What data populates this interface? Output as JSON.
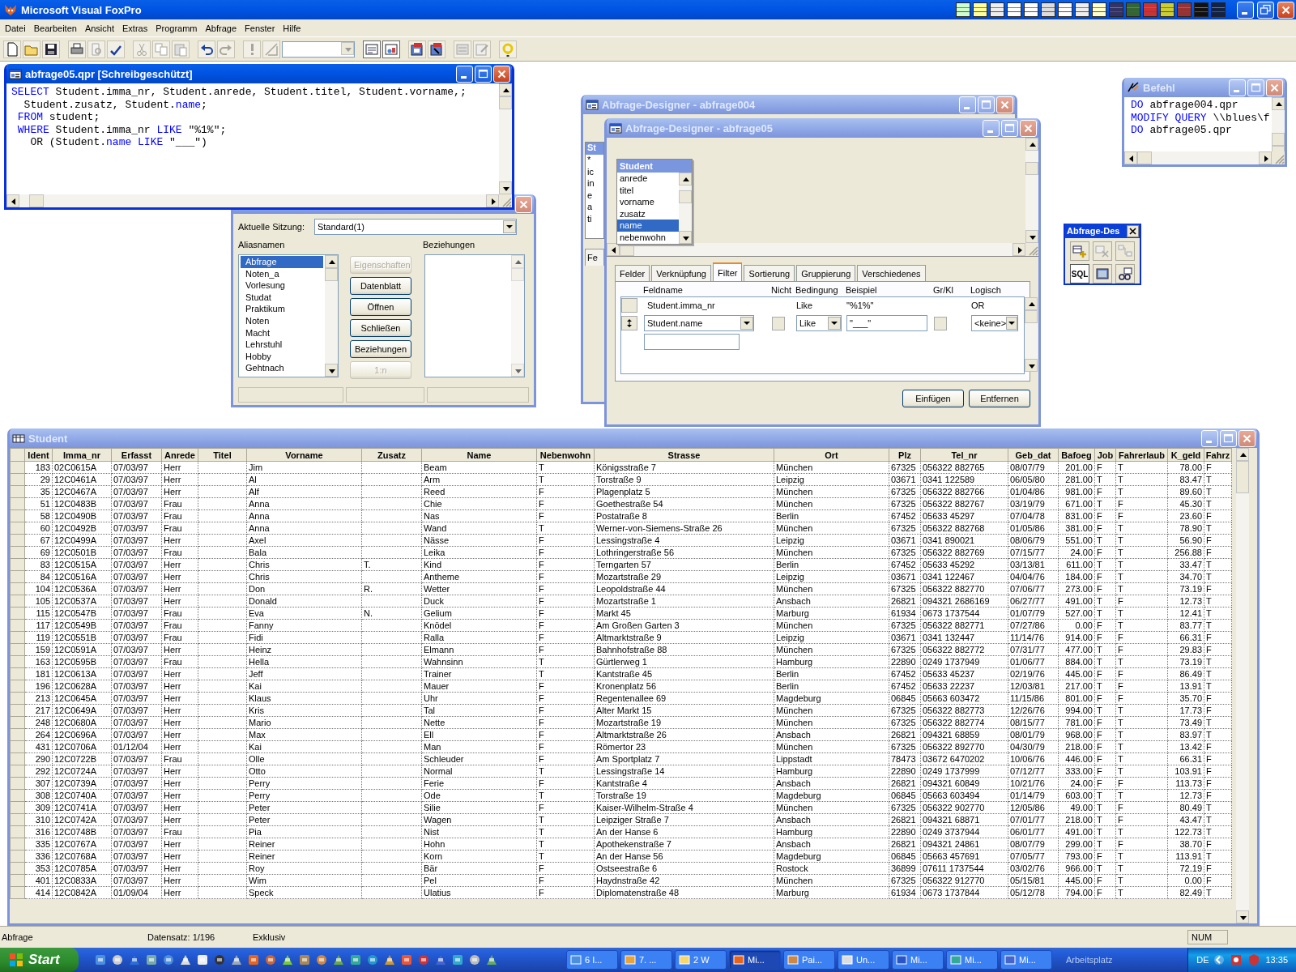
{
  "app": {
    "title": "Microsoft Visual FoxPro"
  },
  "menu": [
    "Datei",
    "Bearbeiten",
    "Ansicht",
    "Extras",
    "Programm",
    "Abfrage",
    "Fenster",
    "Hilfe"
  ],
  "code_window": {
    "title": "abfrage05.qpr [Schreibgeschützt]",
    "active": true,
    "lines": [
      [
        {
          "text": "SELECT",
          "kind": "keyword"
        },
        {
          "text": " Student.imma_nr, Student.anrede, Student.titel, Student.vorname,;",
          "kind": "plain"
        }
      ],
      [
        {
          "text": "  Student.zusatz, Student.",
          "kind": "plain"
        },
        {
          "text": "name",
          "kind": "keyword"
        },
        {
          "text": ";",
          "kind": "plain"
        }
      ],
      [
        {
          "text": " FROM",
          "kind": "keyword"
        },
        {
          "text": " student;",
          "kind": "plain"
        }
      ],
      [
        {
          "text": " WHERE",
          "kind": "keyword"
        },
        {
          "text": " Student.imma_nr ",
          "kind": "plain"
        },
        {
          "text": "LIKE",
          "kind": "keyword"
        },
        {
          "text": " \"%1%\";",
          "kind": "plain"
        }
      ],
      [
        {
          "text": "   OR (Student.",
          "kind": "plain"
        },
        {
          "text": "name",
          "kind": "keyword"
        },
        {
          "text": " LIKE",
          "kind": "keyword"
        },
        {
          "text": " \"___\")",
          "kind": "plain"
        }
      ]
    ]
  },
  "data_session": {
    "active": false,
    "session_label": "Aktuelle Sitzung:",
    "session": "Standard(1)",
    "aliases_label": "Aliasnamen",
    "relations_label": "Beziehungen",
    "aliases": [
      {
        "name": "Abfrage",
        "selected": true
      },
      {
        "name": "Noten_a",
        "selected": false
      },
      {
        "name": "Vorlesung",
        "selected": false
      },
      {
        "name": "Studat",
        "selected": false
      },
      {
        "name": "Praktikum",
        "selected": false
      },
      {
        "name": "Noten",
        "selected": false
      },
      {
        "name": "Macht",
        "selected": false
      },
      {
        "name": "Lehrstuhl",
        "selected": false
      },
      {
        "name": "Hobby",
        "selected": false
      },
      {
        "name": "Gehtnach",
        "selected": false
      }
    ],
    "buttons": [
      {
        "label": "Eigenschaften",
        "disabled": true
      },
      {
        "label": "Datenblatt",
        "disabled": false
      },
      {
        "label": "Öffnen",
        "disabled": false
      },
      {
        "label": "Schließen",
        "disabled": false
      },
      {
        "label": "Beziehungen",
        "disabled": false
      },
      {
        "label": "1:n",
        "disabled": true
      }
    ]
  },
  "designer_back": {
    "title": "Abfrage-Designer - abfrage004",
    "active": false,
    "table_title": "St",
    "fields": [
      "*",
      "ic",
      "in",
      "e",
      "a",
      "ti"
    ],
    "tab": "Fe"
  },
  "designer": {
    "title": "Abfrage-Designer - abfrage05",
    "active": false,
    "table": {
      "title": "Student",
      "fields": [
        {
          "name": "anrede",
          "selected": false
        },
        {
          "name": "titel",
          "selected": false
        },
        {
          "name": "vorname",
          "selected": false
        },
        {
          "name": "zusatz",
          "selected": false
        },
        {
          "name": "name",
          "selected": true
        },
        {
          "name": "nebenwohn",
          "selected": false
        }
      ]
    },
    "tabs": [
      {
        "label": "Felder",
        "selected": false
      },
      {
        "label": "Verknüpfung",
        "selected": false
      },
      {
        "label": "Filter",
        "selected": true
      },
      {
        "label": "Sortierung",
        "selected": false
      },
      {
        "label": "Gruppierung",
        "selected": false
      },
      {
        "label": "Verschiedenes",
        "selected": false
      }
    ],
    "filter": {
      "columns": [
        "Feldname",
        "Nicht",
        "Bedingung",
        "Beispiel",
        "Gr/Kl",
        "Logisch"
      ],
      "rows": [
        {
          "kind": "text",
          "field": "Student.imma_nr",
          "condition": "Like",
          "example": "\"%1%\"",
          "logic": "OR"
        },
        {
          "kind": "edit",
          "field": "Student.name",
          "negated": false,
          "condition": "Like",
          "example": "\"___\"",
          "case_sensitive": false,
          "logic": "<keine>"
        }
      ]
    },
    "buttons": [
      "Einfügen",
      "Entfernen"
    ]
  },
  "command_window": {
    "title": "Befehl",
    "active": false,
    "lines": [
      [
        {
          "text": "DO",
          "kind": "keyword"
        },
        {
          "text": " abfrage004.qpr",
          "kind": "plain"
        }
      ],
      [
        {
          "text": "MODIFY QUERY",
          "kind": "keyword"
        },
        {
          "text": " \\\\blues\\f",
          "kind": "plain"
        }
      ],
      [
        {
          "text": "DO",
          "kind": "keyword"
        },
        {
          "text": " abfrage05.qpr",
          "kind": "plain"
        }
      ]
    ]
  },
  "designer_toolbar": {
    "title": "Abfrage-Des",
    "sql": "SQL"
  },
  "browse": {
    "title": "Student",
    "active": false,
    "columns": [
      {
        "label": "Ident",
        "kind": "number"
      },
      {
        "label": "Imma_nr",
        "kind": "text"
      },
      {
        "label": "Erfasst",
        "kind": "text"
      },
      {
        "label": "Anrede",
        "kind": "text"
      },
      {
        "label": "Titel",
        "kind": "text"
      },
      {
        "label": "Vorname",
        "kind": "text"
      },
      {
        "label": "Zusatz",
        "kind": "text"
      },
      {
        "label": "Name",
        "kind": "text"
      },
      {
        "label": "Nebenwohn",
        "kind": "text"
      },
      {
        "label": "Strasse",
        "kind": "text"
      },
      {
        "label": "Ort",
        "kind": "text"
      },
      {
        "label": "Plz",
        "kind": "text"
      },
      {
        "label": "Tel_nr",
        "kind": "text"
      },
      {
        "label": "Geb_dat",
        "kind": "text"
      },
      {
        "label": "Bafoeg",
        "kind": "number"
      },
      {
        "label": "Job",
        "kind": "text"
      },
      {
        "label": "Fahrerlaub",
        "kind": "text"
      },
      {
        "label": "K_geld",
        "kind": "number"
      },
      {
        "label": "Fahrz",
        "kind": "text"
      }
    ],
    "rows": [
      [
        "183",
        "02C0615A",
        "07/03/97",
        "Herr",
        "",
        "Jim",
        "",
        "Beam",
        "T",
        "Königsstraße 7",
        "München",
        "67325",
        "056322 882765",
        "08/07/79",
        "201.00",
        "F",
        "T",
        "78.00",
        "F"
      ],
      [
        "29",
        "12C0461A",
        "07/03/97",
        "Herr",
        "",
        "Al",
        "",
        "Arm",
        "T",
        "Torstraße 9",
        "Leipzig",
        "03671",
        "0341 122589",
        "06/05/80",
        "281.00",
        "T",
        "T",
        "83.47",
        "T"
      ],
      [
        "35",
        "12C0467A",
        "07/03/97",
        "Herr",
        "",
        "Alf",
        "",
        "Reed",
        "F",
        "Plagenplatz 5",
        "München",
        "67325",
        "056322 882766",
        "01/04/86",
        "981.00",
        "F",
        "T",
        "89.60",
        "T"
      ],
      [
        "51",
        "12C0483B",
        "07/03/97",
        "Frau",
        "",
        "Anna",
        "",
        "Chie",
        "F",
        "Goethestraße 54",
        "München",
        "67325",
        "056322 882767",
        "03/19/79",
        "671.00",
        "T",
        "F",
        "45.30",
        "T"
      ],
      [
        "58",
        "12C0490B",
        "07/03/97",
        "Frau",
        "",
        "Anna",
        "",
        "Nas",
        "F",
        "Postatraße 8",
        "Berlin",
        "67452",
        "05633 45297",
        "07/04/78",
        "831.00",
        "F",
        "F",
        "23.60",
        "F"
      ],
      [
        "60",
        "12C0492B",
        "07/03/97",
        "Frau",
        "",
        "Anna",
        "",
        "Wand",
        "T",
        "Werner-von-Siemens-Straße 26",
        "München",
        "67325",
        "056322 882768",
        "01/05/86",
        "381.00",
        "F",
        "T",
        "78.90",
        "T"
      ],
      [
        "67",
        "12C0499A",
        "07/03/97",
        "Herr",
        "",
        "Axel",
        "",
        "Nässe",
        "F",
        "Lessingstraße 4",
        "Leipzig",
        "03671",
        "0341 890021",
        "08/06/79",
        "551.00",
        "T",
        "T",
        "56.90",
        "F"
      ],
      [
        "69",
        "12C0501B",
        "07/03/97",
        "Frau",
        "",
        "Bala",
        "",
        "Leika",
        "F",
        "Lothringerstraße 56",
        "München",
        "67325",
        "056322 882769",
        "07/15/77",
        "24.00",
        "F",
        "T",
        "256.88",
        "F"
      ],
      [
        "83",
        "12C0515A",
        "07/03/97",
        "Herr",
        "",
        "Chris",
        "T.",
        "Kind",
        "F",
        "Terngarten 57",
        "Berlin",
        "67452",
        "05633 45292",
        "03/13/81",
        "611.00",
        "T",
        "T",
        "33.47",
        "T"
      ],
      [
        "84",
        "12C0516A",
        "07/03/97",
        "Herr",
        "",
        "Chris",
        "",
        "Antheme",
        "F",
        "Mozartstraße 29",
        "Leipzig",
        "03671",
        "0341 122467",
        "04/04/76",
        "184.00",
        "F",
        "T",
        "34.70",
        "T"
      ],
      [
        "104",
        "12C0536A",
        "07/03/97",
        "Herr",
        "",
        "Don",
        "R.",
        "Wetter",
        "F",
        "Leopoldstraße 44",
        "München",
        "67325",
        "056322 882770",
        "07/06/77",
        "273.00",
        "F",
        "T",
        "73.19",
        "F"
      ],
      [
        "105",
        "12C0537A",
        "07/03/97",
        "Herr",
        "",
        "Donald",
        "",
        "Duck",
        "F",
        "Mozartstraße 1",
        "Ansbach",
        "26821",
        "094321 2686169",
        "06/27/77",
        "491.00",
        "T",
        "F",
        "12.73",
        "T"
      ],
      [
        "115",
        "12C0547B",
        "07/03/97",
        "Frau",
        "",
        "Eva",
        "N.",
        "Gelium",
        "F",
        "Markt 45",
        "Marburg",
        "61934",
        "0673 1737544",
        "01/07/79",
        "527.00",
        "T",
        "T",
        "12.41",
        "T"
      ],
      [
        "117",
        "12C0549B",
        "07/03/97",
        "Frau",
        "",
        "Fanny",
        "",
        "Knödel",
        "F",
        "Am Großen Garten 3",
        "München",
        "67325",
        "056322 882771",
        "07/27/86",
        "0.00",
        "F",
        "T",
        "83.77",
        "T"
      ],
      [
        "119",
        "12C0551B",
        "07/03/97",
        "Frau",
        "",
        "Fidi",
        "",
        "Ralla",
        "F",
        "Altmarktstraße 9",
        "Leipzig",
        "03671",
        "0341 132447",
        "11/14/76",
        "914.00",
        "F",
        "F",
        "66.31",
        "F"
      ],
      [
        "159",
        "12C0591A",
        "07/03/97",
        "Herr",
        "",
        "Heinz",
        "",
        "Elmann",
        "F",
        "Bahnhofstraße 88",
        "München",
        "67325",
        "056322 882772",
        "07/31/77",
        "477.00",
        "T",
        "F",
        "29.83",
        "F"
      ],
      [
        "163",
        "12C0595B",
        "07/03/97",
        "Frau",
        "",
        "Hella",
        "",
        "Wahnsinn",
        "T",
        "Gürtlerweg 1",
        "Hamburg",
        "22890",
        "0249 1737949",
        "01/06/77",
        "884.00",
        "T",
        "T",
        "73.19",
        "T"
      ],
      [
        "181",
        "12C0613A",
        "07/03/97",
        "Herr",
        "",
        "Jeff",
        "",
        "Trainer",
        "T",
        "Kantstraße 45",
        "Berlin",
        "67452",
        "05633 45237",
        "02/19/76",
        "445.00",
        "F",
        "F",
        "86.49",
        "T"
      ],
      [
        "196",
        "12C0628A",
        "07/03/97",
        "Herr",
        "",
        "Kai",
        "",
        "Mauer",
        "F",
        "Kronenplatz 56",
        "Berlin",
        "67452",
        "05633 22237",
        "12/03/81",
        "217.00",
        "T",
        "F",
        "13.91",
        "T"
      ],
      [
        "213",
        "12C0645A",
        "07/03/97",
        "Herr",
        "",
        "Klaus",
        "",
        "Uhr",
        "F",
        "Regentenallee 69",
        "Magdeburg",
        "06845",
        "05663 603472",
        "11/15/86",
        "801.00",
        "F",
        "F",
        "35.70",
        "F"
      ],
      [
        "217",
        "12C0649A",
        "07/03/97",
        "Herr",
        "",
        "Kris",
        "",
        "Tal",
        "F",
        "Alter Markt 15",
        "München",
        "67325",
        "056322 882773",
        "12/26/76",
        "994.00",
        "T",
        "T",
        "17.73",
        "F"
      ],
      [
        "248",
        "12C0680A",
        "07/03/97",
        "Herr",
        "",
        "Mario",
        "",
        "Nette",
        "F",
        "Mozartstraße 19",
        "München",
        "67325",
        "056322 882774",
        "08/15/77",
        "781.00",
        "F",
        "T",
        "73.49",
        "T"
      ],
      [
        "264",
        "12C0696A",
        "07/03/97",
        "Herr",
        "",
        "Max",
        "",
        "Ell",
        "F",
        "Altmarktstraße 26",
        "Ansbach",
        "26821",
        "094321 68859",
        "08/01/79",
        "968.00",
        "F",
        "T",
        "83.97",
        "T"
      ],
      [
        "431",
        "12C0706A",
        "01/12/04",
        "Herr",
        "",
        "Kai",
        "",
        "Man",
        "F",
        "Römertor 23",
        "München",
        "67325",
        "056322 892770",
        "04/30/79",
        "218.00",
        "F",
        "T",
        "13.42",
        "F"
      ],
      [
        "290",
        "12C0722B",
        "07/03/97",
        "Frau",
        "",
        "Olle",
        "",
        "Schleuder",
        "F",
        "Am Sportplatz 7",
        "Lippstadt",
        "78473",
        "03672 6470202",
        "10/06/76",
        "446.00",
        "F",
        "T",
        "66.31",
        "F"
      ],
      [
        "292",
        "12C0724A",
        "07/03/97",
        "Herr",
        "",
        "Otto",
        "",
        "Normal",
        "T",
        "Lessingstraße 14",
        "Hamburg",
        "22890",
        "0249 1737999",
        "07/12/77",
        "333.00",
        "F",
        "T",
        "103.91",
        "F"
      ],
      [
        "307",
        "12C0739A",
        "07/03/97",
        "Herr",
        "",
        "Perry",
        "",
        "Ferie",
        "F",
        "Kantstraße 4",
        "Ansbach",
        "26821",
        "094321 60849",
        "10/21/76",
        "24.00",
        "F",
        "F",
        "113.73",
        "F"
      ],
      [
        "308",
        "12C0740A",
        "07/03/97",
        "Herr",
        "",
        "Perry",
        "",
        "Ode",
        "T",
        "Torstraße 19",
        "Magdeburg",
        "06845",
        "05663 603494",
        "01/14/79",
        "603.00",
        "T",
        "T",
        "12.73",
        "F"
      ],
      [
        "309",
        "12C0741A",
        "07/03/97",
        "Herr",
        "",
        "Peter",
        "",
        "Silie",
        "F",
        "Kaiser-Wilhelm-Straße 4",
        "München",
        "67325",
        "056322 902770",
        "12/05/86",
        "49.00",
        "T",
        "F",
        "80.49",
        "T"
      ],
      [
        "310",
        "12C0742A",
        "07/03/97",
        "Herr",
        "",
        "Peter",
        "",
        "Wagen",
        "T",
        "Leipziger Straße 7",
        "Ansbach",
        "26821",
        "094321 68871",
        "07/01/77",
        "218.00",
        "T",
        "F",
        "43.47",
        "T"
      ],
      [
        "316",
        "12C0748B",
        "07/03/97",
        "Frau",
        "",
        "Pia",
        "",
        "Nist",
        "T",
        "An der Hanse 6",
        "Hamburg",
        "22890",
        "0249 3737944",
        "06/01/77",
        "491.00",
        "T",
        "T",
        "122.73",
        "T"
      ],
      [
        "335",
        "12C0767A",
        "07/03/97",
        "Herr",
        "",
        "Reiner",
        "",
        "Hohn",
        "T",
        "Apothekenstraße 7",
        "Ansbach",
        "26821",
        "094321 24861",
        "08/07/79",
        "299.00",
        "T",
        "F",
        "38.70",
        "F"
      ],
      [
        "336",
        "12C0768A",
        "07/03/97",
        "Herr",
        "",
        "Reiner",
        "",
        "Korn",
        "T",
        "An der Hanse 56",
        "Magdeburg",
        "06845",
        "05663 457691",
        "07/05/77",
        "793.00",
        "F",
        "T",
        "113.91",
        "T"
      ],
      [
        "353",
        "12C0785A",
        "07/03/97",
        "Herr",
        "",
        "Roy",
        "",
        "Bär",
        "F",
        "Ostseestraße 6",
        "Rostock",
        "36899",
        "07611 1737544",
        "03/02/76",
        "966.00",
        "T",
        "T",
        "72.19",
        "F"
      ],
      [
        "401",
        "12C0833A",
        "07/03/97",
        "Herr",
        "",
        "Wim",
        "",
        "Pel",
        "F",
        "Haydnstraße 42",
        "München",
        "67325",
        "056322 912770",
        "05/15/81",
        "445.00",
        "F",
        "T",
        "0.00",
        "F"
      ],
      [
        "414",
        "12C0842A",
        "01/09/04",
        "Herr",
        "",
        "Speck",
        "",
        "Ulatius",
        "F",
        "Diplomatenstraße 48",
        "Marburg",
        "61934",
        "0673 1737844",
        "05/12/78",
        "794.00",
        "F",
        "T",
        "82.49",
        "T"
      ]
    ]
  },
  "status_bar": [
    "Abfrage",
    "Datensatz: 1/196",
    "Exklusiv",
    "NUM"
  ],
  "taskbar": {
    "start": "Start",
    "tasks": [
      {
        "label": "6 I...",
        "selected": false
      },
      {
        "label": "7. ...",
        "selected": false
      },
      {
        "label": "2 W",
        "selected": false
      },
      {
        "label": "Mi...",
        "selected": true
      },
      {
        "label": "Pai...",
        "selected": false
      },
      {
        "label": "Un...",
        "selected": false
      },
      {
        "label": "Mi...",
        "selected": false
      },
      {
        "label": "Mi...",
        "selected": false
      },
      {
        "label": "Mi...",
        "selected": false
      }
    ],
    "toolbar_label": "Arbeitsplatz",
    "language": "DE",
    "clock": "13:35"
  }
}
